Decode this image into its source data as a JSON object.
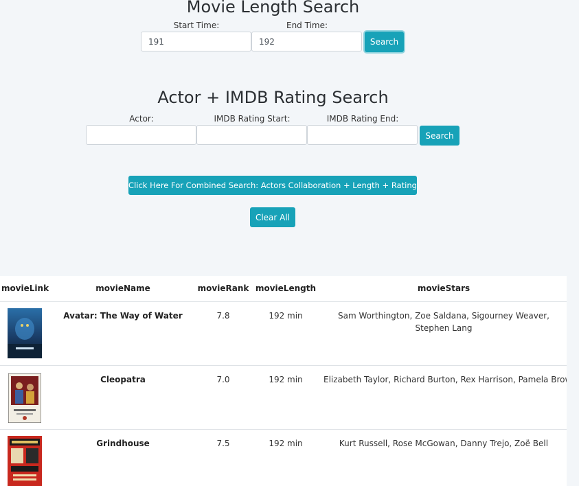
{
  "length_search": {
    "title": "Movie Length Search",
    "start_label": "Start Time:",
    "end_label": "End Time:",
    "start_value": "191",
    "end_value": "192",
    "search_label": "Search"
  },
  "actor_search": {
    "title": "Actor + IMDB Rating Search",
    "actor_label": "Actor:",
    "rating_start_label": "IMDB Rating Start:",
    "rating_end_label": "IMDB Rating End:",
    "actor_value": "",
    "rating_start_value": "",
    "rating_end_value": "",
    "search_label": "Search"
  },
  "combined_button_label": "Click Here For Combined Search: Actors Collaboration + Length + Rating",
  "clear_button_label": "Clear All",
  "accent_color": "#17a2b8",
  "table": {
    "headers": [
      "movieLink",
      "movieName",
      "movieRank",
      "movieLength",
      "movieStars"
    ],
    "rows": [
      {
        "poster": "avatar-poster",
        "name": "Avatar: The Way of Water",
        "rank": "7.8",
        "length": "192 min",
        "stars": "Sam Worthington, Zoe Saldana, Sigourney Weaver, Stephen Lang"
      },
      {
        "poster": "cleopatra-poster",
        "name": "Cleopatra",
        "rank": "7.0",
        "length": "192 min",
        "stars": "Elizabeth Taylor, Richard Burton, Rex Harrison, Pamela Brown"
      },
      {
        "poster": "grindhouse-poster",
        "name": "Grindhouse",
        "rank": "7.5",
        "length": "192 min",
        "stars": "Kurt Russell, Rose McGowan, Danny Trejo, Zoë Bell"
      }
    ]
  }
}
